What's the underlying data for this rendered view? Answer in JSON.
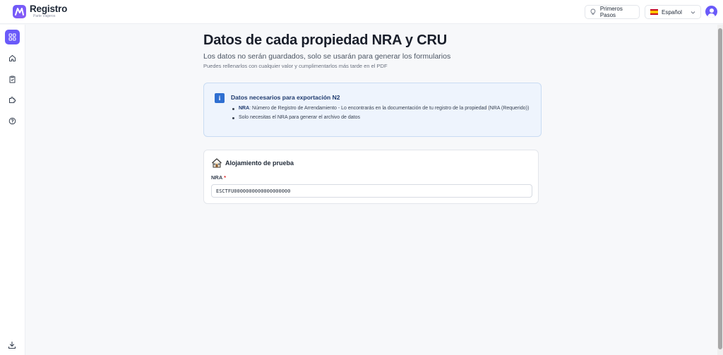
{
  "header": {
    "brand_title": "Registro",
    "brand_subtitle": "Parte Viajeros",
    "first_steps_label": "Primeros Pasos",
    "language_label": "Español"
  },
  "sidebar": {
    "items": [
      {
        "icon": "grid-icon",
        "active": true
      },
      {
        "icon": "home-icon",
        "active": false
      },
      {
        "icon": "clipboard-check-icon",
        "active": false
      },
      {
        "icon": "puzzle-icon",
        "active": false
      },
      {
        "icon": "help-circle-icon",
        "active": false
      }
    ],
    "bottom_icon": "download-icon"
  },
  "page": {
    "title": "Datos de cada propiedad NRA y CRU",
    "subtitle": "Los datos no serán guardados, solo se usarán para generar los formularios",
    "note": "Puedes rellenarlos con cualquier valor y cumplimentarlos más tarde en el PDF"
  },
  "info_box": {
    "title": "Datos necesarios para exportación N2",
    "item1_bold": "NRA",
    "item1_text": ": Número de Registro de Arrendamiento - Lo encontrarás en la documentación de tu registro de la propiedad (NRA (Requerido))",
    "item2_text": "Solo necesitas el NRA para generar el archivo de datos"
  },
  "property_card": {
    "title": "Alojamiento de prueba",
    "field_label": "NRA",
    "required_mark": "*",
    "field_value": "ESCTFU0000000000000000000"
  },
  "colors": {
    "accent": "#6a5af9",
    "info_bg": "#eef4fd",
    "info_border": "#c9dcf3",
    "info_icon": "#2f6fd1"
  }
}
